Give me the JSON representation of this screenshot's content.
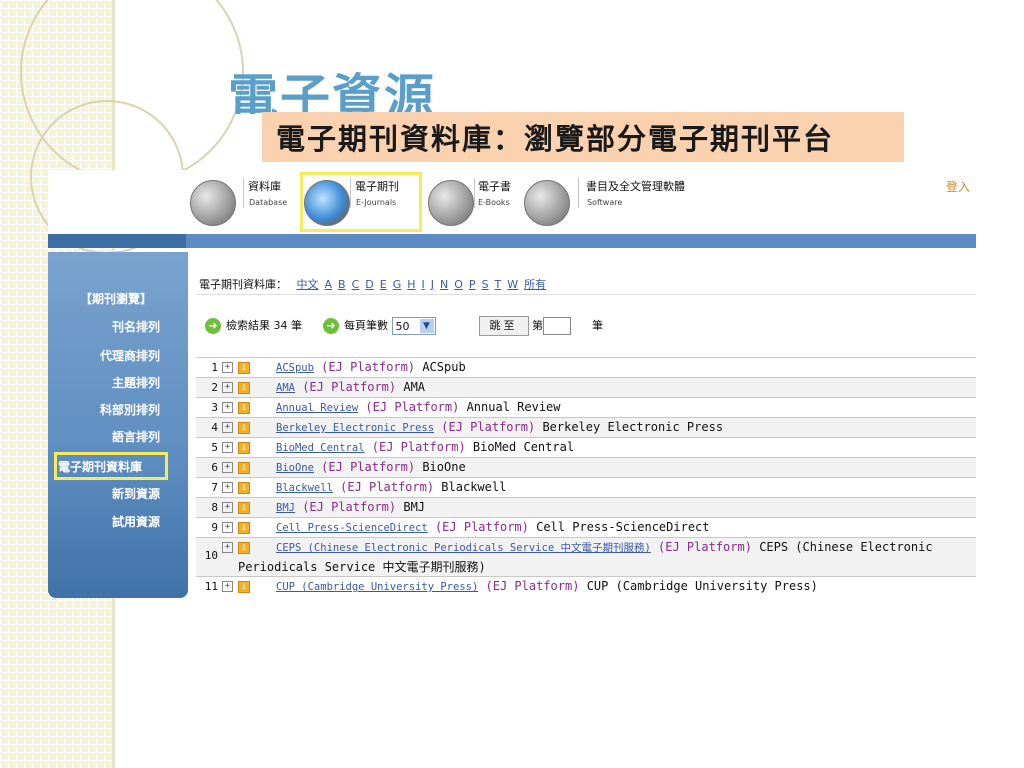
{
  "slide": {
    "title": "電子資源",
    "subtitle": "電子期刊資料庫：瀏覽部分電子期刊平台"
  },
  "toolbar": {
    "items": [
      {
        "label": "資料庫",
        "sub": "Database",
        "icon": "database-icon"
      },
      {
        "label": "電子期刊",
        "sub": "E-Journals",
        "icon": "ejournals-icon"
      },
      {
        "label": "電子書",
        "sub": "E-Books",
        "icon": "ebooks-icon"
      },
      {
        "label": "書目及全文管理軟體",
        "sub": "Software",
        "icon": "software-icon"
      }
    ],
    "login": "登入"
  },
  "sidebar": {
    "header": "【期刊瀏覽】",
    "items": [
      {
        "label": "刊名排列"
      },
      {
        "label": "代理商排列"
      },
      {
        "label": "主題排列"
      },
      {
        "label": "科部別排列"
      },
      {
        "label": "語言排列"
      },
      {
        "label": "電子期刊資料庫"
      },
      {
        "label": "新到資源"
      },
      {
        "label": "試用資源"
      }
    ],
    "active_index": 5
  },
  "alphabet": {
    "label": "電子期刊資料庫：",
    "links": [
      "中文",
      "A",
      "B",
      "C",
      "D",
      "E",
      "G",
      "H",
      "I",
      "J",
      "N",
      "O",
      "P",
      "S",
      "T",
      "W",
      "所有"
    ]
  },
  "controls": {
    "result_label": "檢索結果 34 筆",
    "per_page_label": "每頁筆數",
    "per_page_value": "50",
    "goto_button": "跳至",
    "page_prefix": "第",
    "page_suffix": "筆"
  },
  "results": [
    {
      "num": "1",
      "link": "ACSpub",
      "platform": "(EJ Platform)",
      "name": "ACSpub"
    },
    {
      "num": "2",
      "link": "AMA",
      "platform": "(EJ Platform)",
      "name": "AMA"
    },
    {
      "num": "3",
      "link": "Annual Review",
      "platform": "(EJ Platform)",
      "name": "Annual Review"
    },
    {
      "num": "4",
      "link": "Berkeley Electronic Press",
      "platform": "(EJ Platform)",
      "name": "Berkeley Electronic Press"
    },
    {
      "num": "5",
      "link": "BioMed Central",
      "platform": "(EJ Platform)",
      "name": "BioMed Central"
    },
    {
      "num": "6",
      "link": "BioOne",
      "platform": "(EJ Platform)",
      "name": "BioOne"
    },
    {
      "num": "7",
      "link": "Blackwell",
      "platform": "(EJ Platform)",
      "name": "Blackwell"
    },
    {
      "num": "8",
      "link": "BMJ",
      "platform": "(EJ Platform)",
      "name": "BMJ"
    },
    {
      "num": "9",
      "link": "Cell Press-ScienceDirect",
      "platform": "(EJ Platform)",
      "name": "Cell Press-ScienceDirect"
    },
    {
      "num": "10",
      "link": "CEPS (Chinese Electronic Periodicals Service 中文電子期刊服務)",
      "platform": "(EJ Platform)",
      "name": "CEPS (Chinese Electronic",
      "name2": "Periodicals Service 中文電子期刊服務)"
    },
    {
      "num": "11",
      "link": "CUP (Cambridge University Press)",
      "platform": "(EJ Platform)",
      "name": "CUP (Cambridge University Press)"
    }
  ]
}
